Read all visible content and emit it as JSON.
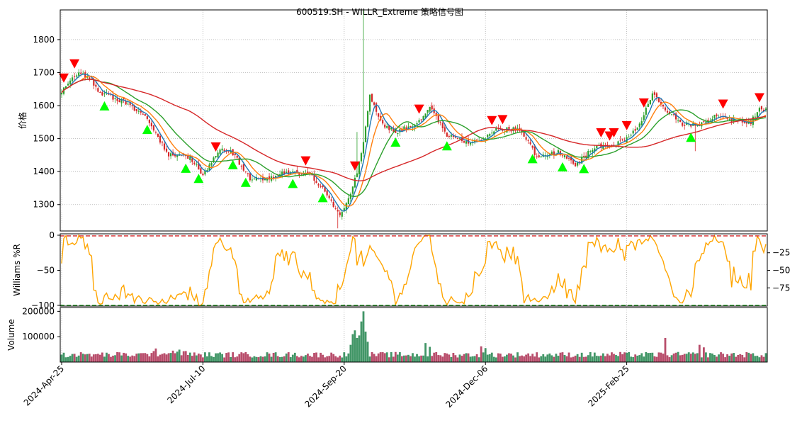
{
  "chart_data": {
    "type": "candlestick",
    "title": "600519.SH - WILLR_Extreme 策略信号图",
    "price_panel": {
      "ylabel": "价格",
      "ylim": [
        1220,
        1890
      ],
      "yticks": [
        1300,
        1400,
        1500,
        1600,
        1700,
        1800
      ],
      "ytick_labels": [
        "1300",
        "1400",
        "1500",
        "1600",
        "1700",
        "1800"
      ],
      "grid": true,
      "close_anchors": [
        {
          "i": 0,
          "v": 1640
        },
        {
          "i": 6,
          "v": 1695
        },
        {
          "i": 12,
          "v": 1690
        },
        {
          "i": 18,
          "v": 1640
        },
        {
          "i": 30,
          "v": 1610
        },
        {
          "i": 40,
          "v": 1560
        },
        {
          "i": 50,
          "v": 1450
        },
        {
          "i": 60,
          "v": 1445
        },
        {
          "i": 66,
          "v": 1390
        },
        {
          "i": 74,
          "v": 1470
        },
        {
          "i": 80,
          "v": 1455
        },
        {
          "i": 88,
          "v": 1380
        },
        {
          "i": 94,
          "v": 1375
        },
        {
          "i": 104,
          "v": 1395
        },
        {
          "i": 116,
          "v": 1395
        },
        {
          "i": 124,
          "v": 1330
        },
        {
          "i": 130,
          "v": 1265
        },
        {
          "i": 136,
          "v": 1350
        },
        {
          "i": 140,
          "v": 1450
        },
        {
          "i": 144,
          "v": 1630
        },
        {
          "i": 150,
          "v": 1540
        },
        {
          "i": 156,
          "v": 1520
        },
        {
          "i": 166,
          "v": 1545
        },
        {
          "i": 172,
          "v": 1600
        },
        {
          "i": 180,
          "v": 1510
        },
        {
          "i": 190,
          "v": 1490
        },
        {
          "i": 196,
          "v": 1490
        },
        {
          "i": 202,
          "v": 1525
        },
        {
          "i": 214,
          "v": 1530
        },
        {
          "i": 222,
          "v": 1445
        },
        {
          "i": 232,
          "v": 1460
        },
        {
          "i": 240,
          "v": 1420
        },
        {
          "i": 248,
          "v": 1470
        },
        {
          "i": 256,
          "v": 1480
        },
        {
          "i": 262,
          "v": 1490
        },
        {
          "i": 270,
          "v": 1540
        },
        {
          "i": 276,
          "v": 1640
        },
        {
          "i": 282,
          "v": 1590
        },
        {
          "i": 290,
          "v": 1545
        },
        {
          "i": 298,
          "v": 1540
        },
        {
          "i": 306,
          "v": 1570
        },
        {
          "i": 314,
          "v": 1555
        },
        {
          "i": 322,
          "v": 1550
        },
        {
          "i": 326,
          "v": 1590
        }
      ],
      "moving_averages": [
        {
          "window": 5,
          "color": "#1f77b4"
        },
        {
          "window": 10,
          "color": "#ff7f0e"
        },
        {
          "window": 20,
          "color": "#2ca02c"
        },
        {
          "window": 60,
          "color": "#d62728"
        }
      ],
      "buy_signals": [
        20,
        40,
        58,
        64,
        80,
        86,
        108,
        122,
        156,
        180,
        220,
        234,
        244,
        294
      ],
      "sell_signals": [
        1,
        6,
        72,
        114,
        137,
        167,
        201,
        206,
        252,
        256,
        258,
        264,
        272,
        309,
        326
      ]
    },
    "williams_panel": {
      "ylabel": "Williams %R",
      "ylim": [
        -101,
        2
      ],
      "left_ticks": [
        "0",
        "−50",
        "−100"
      ],
      "left_tick_values": [
        0,
        -50,
        -100
      ],
      "right_ticks": [
        "−25",
        "−50",
        "−75"
      ],
      "right_tick_values": [
        -25,
        -50,
        -75
      ],
      "overbought": -1,
      "oversold": -100,
      "color": "#ffa500"
    },
    "volume_panel": {
      "ylabel": "Volume",
      "ylim": [
        0,
        215000
      ],
      "yticks": [
        "100000",
        "200000"
      ],
      "ytick_values": [
        100000,
        200000
      ],
      "bars": [
        {
          "i": 135,
          "v": 68000
        },
        {
          "i": 136,
          "v": 110000
        },
        {
          "i": 137,
          "v": 125000
        },
        {
          "i": 138,
          "v": 95000
        },
        {
          "i": 139,
          "v": 105000
        },
        {
          "i": 140,
          "v": 160000
        },
        {
          "i": 141,
          "v": 200000
        },
        {
          "i": 142,
          "v": 120000
        },
        {
          "i": 143,
          "v": 80000
        },
        {
          "i": 170,
          "v": 75000
        },
        {
          "i": 172,
          "v": 60000
        },
        {
          "i": 196,
          "v": 62000
        },
        {
          "i": 198,
          "v": 55000
        },
        {
          "i": 282,
          "v": 95000
        },
        {
          "i": 298,
          "v": 68000
        },
        {
          "i": 300,
          "v": 58000
        }
      ]
    },
    "x_axis": {
      "n_points": 330,
      "tick_indices": [
        0,
        66,
        132,
        198,
        264
      ],
      "tick_labels": [
        "2024-Apr-25",
        "2024-Jul-10",
        "2024-Sep-20",
        "2024-Dec-06",
        "2025-Feb-25"
      ]
    }
  }
}
